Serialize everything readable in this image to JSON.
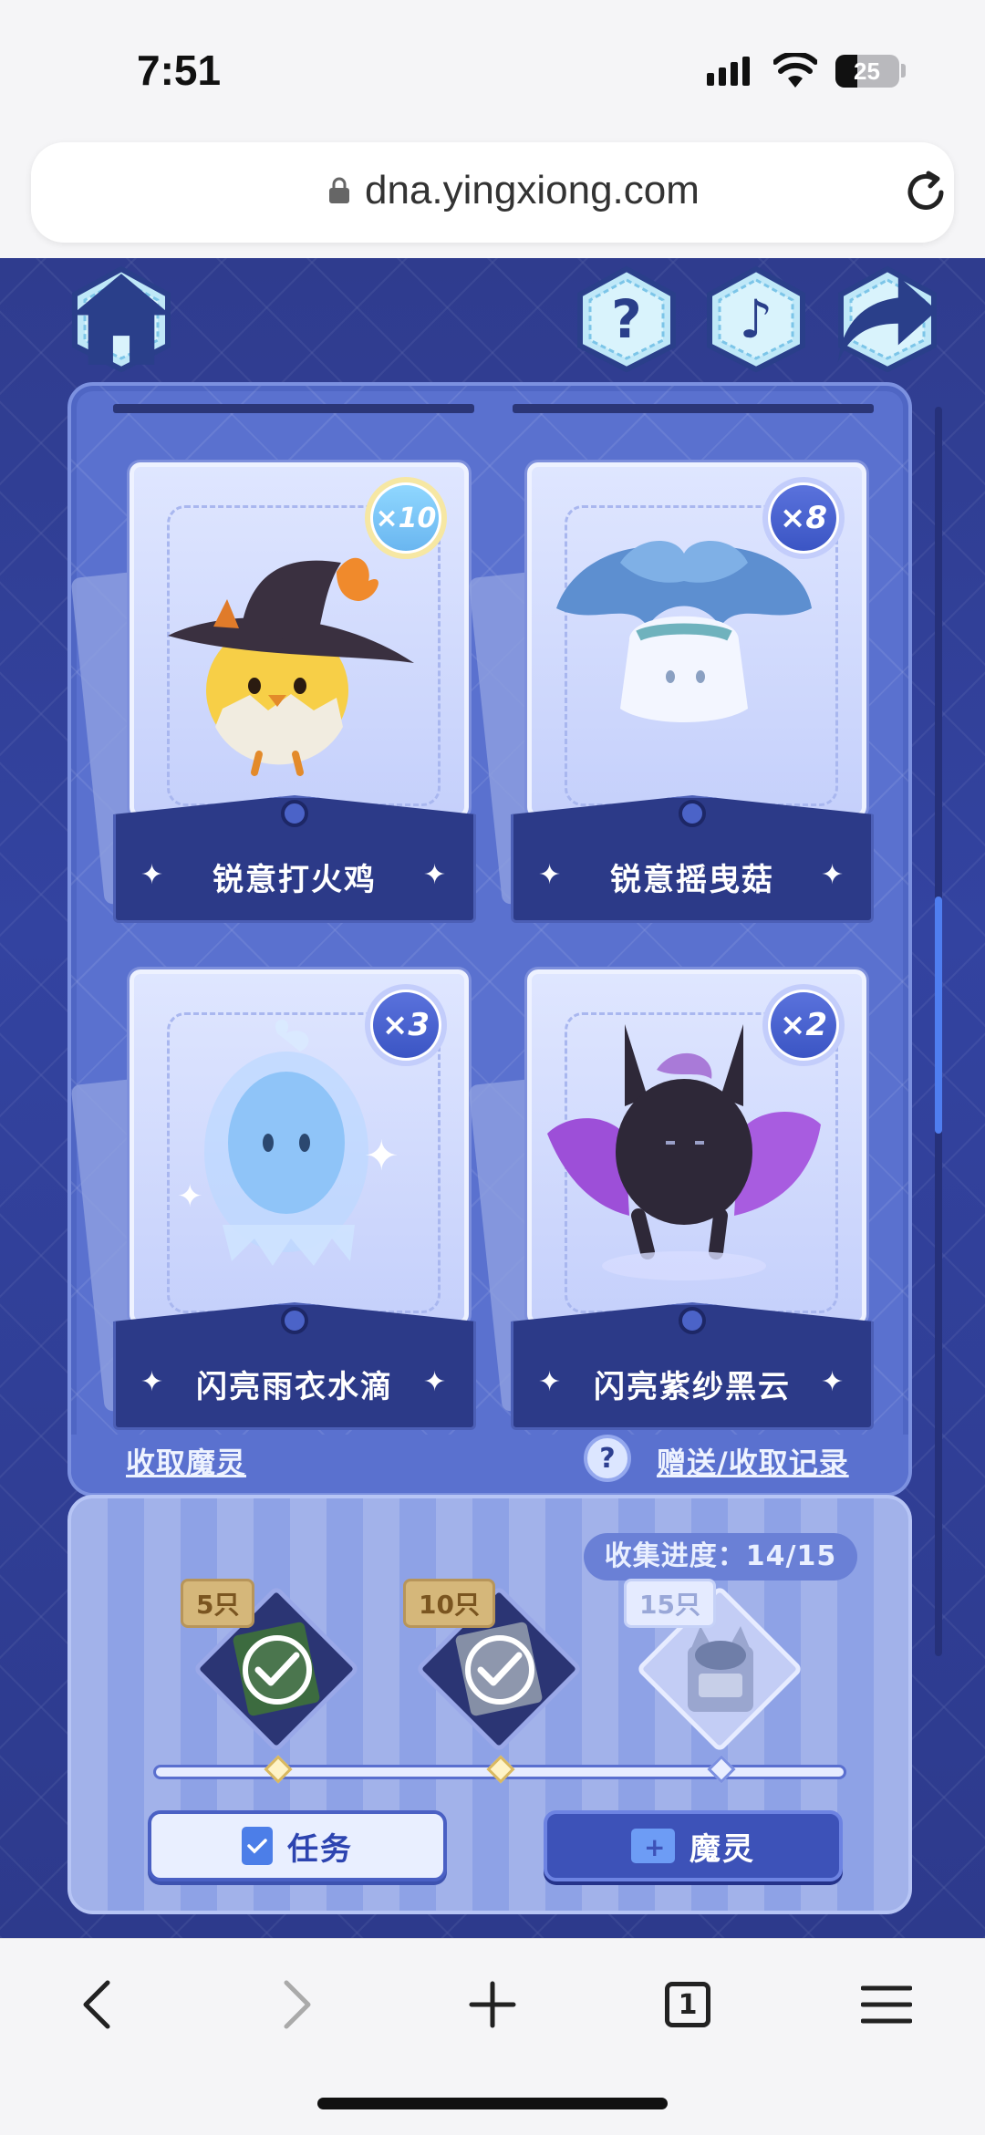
{
  "status_bar": {
    "time": "7:51",
    "battery": "25"
  },
  "browser": {
    "url": "dna.yingxiong.com"
  },
  "top_buttons": [
    {
      "id": "home",
      "icon": "home-icon"
    },
    {
      "id": "help",
      "icon": "question-icon"
    },
    {
      "id": "music",
      "icon": "music-note-icon"
    },
    {
      "id": "share",
      "icon": "share-arrow-icon"
    }
  ],
  "cards": [
    {
      "name": "锐意打火鸡",
      "count": "×10",
      "icon": "fire-chick-witch-hat-icon"
    },
    {
      "name": "锐意摇曳菇",
      "count": "×8",
      "icon": "blue-mushroom-icon"
    },
    {
      "name": "闪亮雨衣水滴",
      "count": "×3",
      "icon": "raincoat-droplet-icon"
    },
    {
      "name": "闪亮紫纱黑云",
      "count": "×2",
      "icon": "purple-bat-cloud-icon"
    }
  ],
  "panel_links": {
    "collect": "收取魔灵",
    "history": "赠送/收取记录"
  },
  "progress": {
    "label": "收集进度：14/15",
    "collected": 14,
    "total": 15,
    "milestones": [
      {
        "label": "5只",
        "claimed": true
      },
      {
        "label": "10只",
        "claimed": true
      },
      {
        "label": "15只",
        "claimed": false
      }
    ]
  },
  "buttons": {
    "task": "任务",
    "spirit": "魔灵"
  },
  "toolbar": {
    "tabs_count": "1"
  },
  "colors": {
    "game_bg": "#3343a0",
    "panel": "#5a71cf",
    "accent": "#4f7ef0"
  }
}
